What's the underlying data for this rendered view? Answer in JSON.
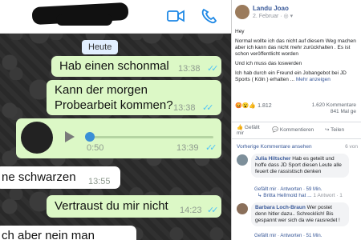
{
  "whatsapp": {
    "date_chip": "Heute",
    "messages": [
      {
        "text": "Hab einen schonmal",
        "time": "13:38"
      },
      {
        "text": "Kann der morgen Probearbeit kommen?",
        "time": "13:38"
      },
      {
        "voice_duration": "0:50",
        "time": "13:39"
      },
      {
        "text": "ne schwarzen",
        "time": "13:55"
      },
      {
        "text": "Vertraust du mir nicht",
        "time": "14:23"
      },
      {
        "text": "ch aber nein man"
      }
    ]
  },
  "facebook": {
    "author": "Landu Joao",
    "date": "2. Februar",
    "body": [
      "Hey",
      "Normal wollte ich das nicht auf diesem Weg machen aber ich kann das nicht mehr zurückhalten . Es ist schon veröffentlicht worden",
      "Und ich muss das loswerden",
      "Ich hab durch ein Freund ein Jobangebot bei JD Sports ( Köln ) erhalten ..."
    ],
    "see_more": "Mehr anzeigen",
    "reactions_count": "1.812",
    "comments_count": "1.620 Kommentare",
    "shares_count": "841 Mal ge",
    "actions": {
      "like": "Gefällt mir",
      "comment": "Kommentieren",
      "share": "Teilen"
    },
    "prev_comments": "Vorherige Kommentare ansehen",
    "prev_count": "6 von",
    "comments": [
      {
        "name": "Julia Hiltscher",
        "text": "Hab es geteilt und hoffe dass JD Sport diesen Leute alle feuert die rassistisch denken",
        "meta": "Gefällt mir · Antworten · 59 Min."
      },
      {
        "name": "Barbara Loch-Braun",
        "text": "Wer postet denn hitler dazu.. Schrecklich! Bis gespannt wer sich da wie rausredet !",
        "meta": "Gefällt mir · Antworten · 51 Min."
      }
    ],
    "reply": {
      "name": "Britta Hellmold hat ...",
      "meta": "1 Antwort · 1"
    }
  },
  "colors": {
    "out_bubble": "#dcf8c6",
    "tick_blue": "#4fc3f7",
    "fb_link": "#385898"
  }
}
